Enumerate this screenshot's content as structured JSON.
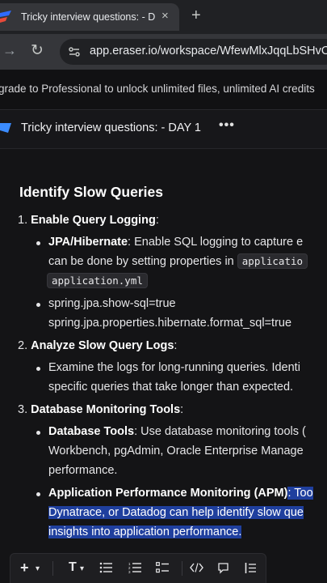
{
  "browser": {
    "tab_title": "Tricky interview questions: - DA",
    "tab_close": "×",
    "new_tab": "+",
    "url": "app.eraser.io/workspace/WfewMlxJqqLbSHvOC"
  },
  "banner": {
    "text": "grade to Professional to unlock unlimited files, unlimited AI credits"
  },
  "doc": {
    "title": "Tricky interview questions: - DAY 1",
    "more": "•••"
  },
  "content": {
    "heading": "Identify Slow Queries",
    "item1": {
      "num": "1.",
      "title": "Enable Query Logging",
      "colon": ":",
      "b1_label": "JPA/Hibernate",
      "b1_text_l1": ": Enable SQL logging to capture e",
      "b1_text_l2": "can be done by setting properties in",
      "b1_code1": "applicatio",
      "b1_code2": "application.yml",
      "b2_l1": "spring.jpa.show-sql=true",
      "b2_l2": "spring.jpa.properties.hibernate.format_sql=true"
    },
    "item2": {
      "num": "2.",
      "title": "Analyze Slow Query Logs",
      "colon": ":",
      "b1_l1": "Examine the logs for long-running queries. Identi",
      "b1_l2": "specific queries that take longer than expected."
    },
    "item3": {
      "num": "3.",
      "title": "Database Monitoring Tools",
      "colon": ":",
      "b1_label": "Database Tools",
      "b1_text_l1": ": Use database monitoring tools (",
      "b1_l2": "Workbench, pgAdmin, Oracle Enterprise Manage",
      "b1_l3": "performance.",
      "b2_label": "Application Performance Monitoring (APM)",
      "b2_text_l1": ": Too",
      "b2_l2": "Dynatrace, or Datadog can help identify slow que",
      "b2_l3": "insights into application performance."
    }
  },
  "format_bar": {
    "add": "+",
    "add_caret": "▾",
    "text_style": "T",
    "text_caret": "▾"
  },
  "colors": {
    "highlight": "#1f3f9e",
    "eraser_brand": "#2f6bff"
  }
}
